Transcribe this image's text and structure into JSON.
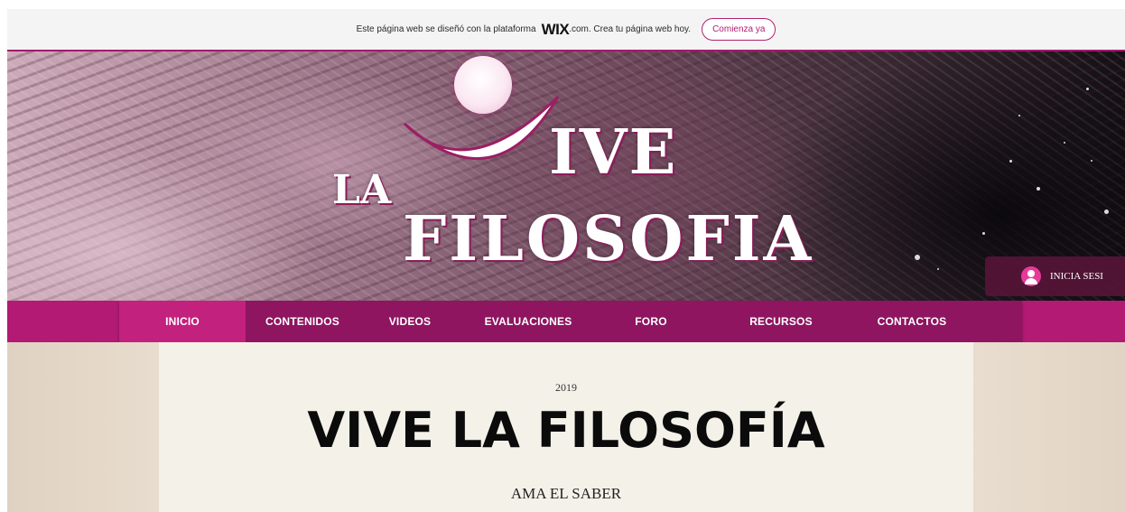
{
  "wix_banner": {
    "text_before": "Este página web se diseñó con la plataforma",
    "logo": "WIX",
    "text_after": ".com. Crea tu página web hoy.",
    "button_label": "Comienza ya"
  },
  "logo": {
    "line1_la": "LA",
    "line1_ive": "IVE",
    "line2": "FILOSOFIA"
  },
  "login": {
    "label": "INICIA SESI",
    "icon": "user-icon"
  },
  "nav": {
    "items": [
      {
        "label": "INICIO",
        "active": true
      },
      {
        "label": "CONTENIDOS",
        "active": false
      },
      {
        "label": "VIDEOS",
        "active": false
      },
      {
        "label": "EVALUACIONES",
        "active": false
      },
      {
        "label": "FORO",
        "active": false
      },
      {
        "label": "RECURSOS",
        "active": false
      },
      {
        "label": "CONTACTOS",
        "active": false
      }
    ]
  },
  "main": {
    "year": "2019",
    "title": "VIVE LA FILOSOFÍA",
    "subtitle": "AMA EL SABER"
  },
  "colors": {
    "accent": "#b21a73",
    "nav_dark": "#8f1560",
    "nav_active": "#c2217e",
    "panel": "#f4f1e8"
  }
}
